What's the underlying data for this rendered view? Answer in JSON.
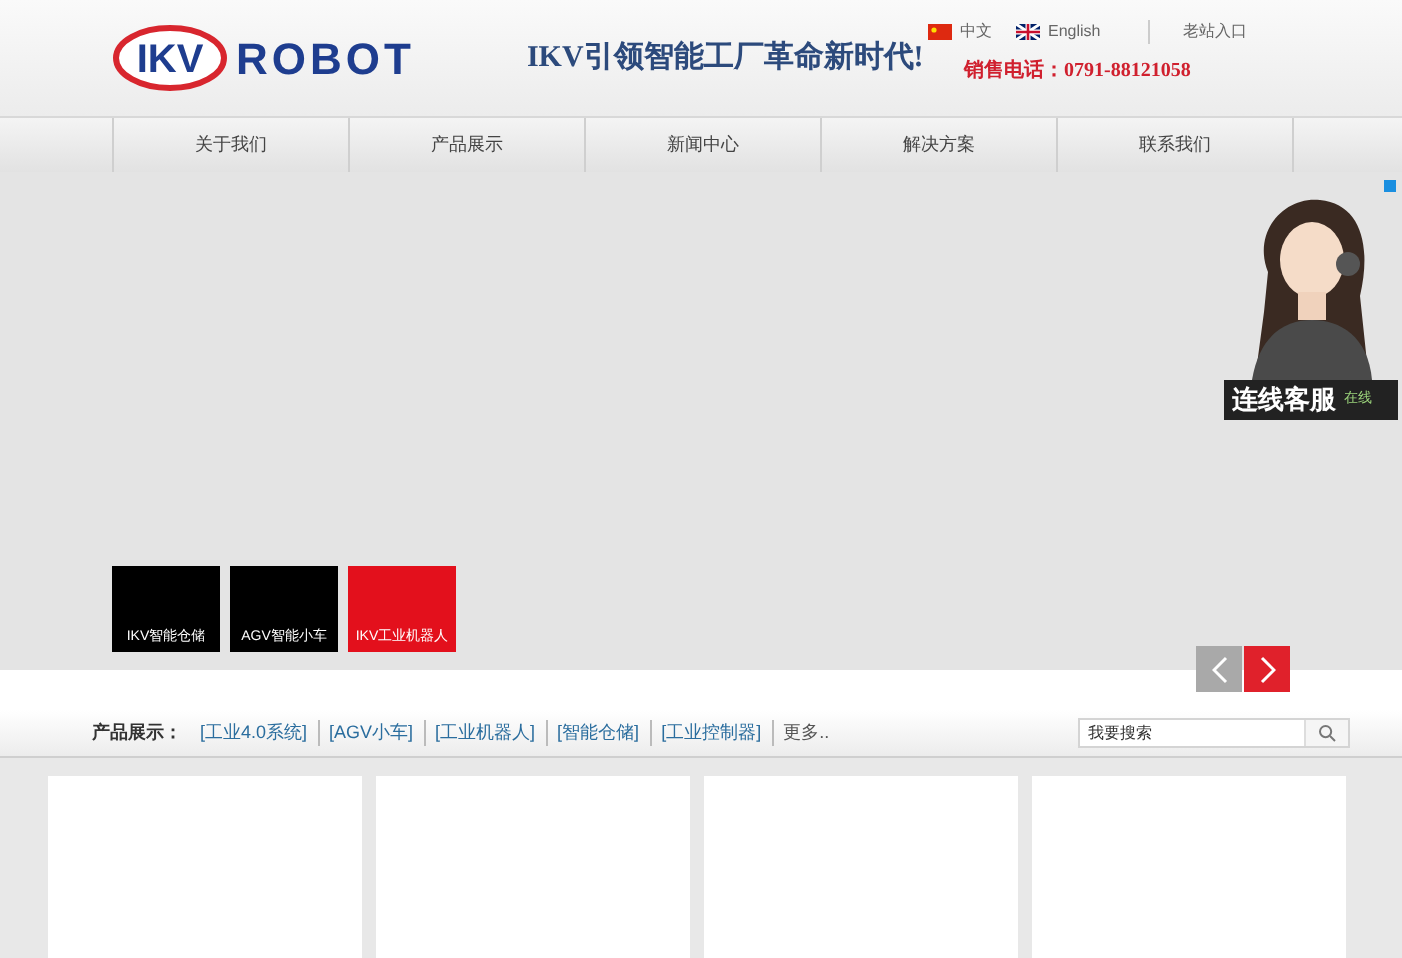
{
  "header": {
    "logo_mark": "IKV",
    "logo_text": "ROBOT",
    "tagline": "IKV引领智能工厂革命新时代!",
    "languages": [
      {
        "label": "中文",
        "kind": "cn"
      },
      {
        "label": "English",
        "kind": "uk"
      }
    ],
    "link": "老站入口",
    "hotline": "销售电话：0791-88121058"
  },
  "nav": [
    "关于我们",
    "产品展示",
    "新闻中心",
    "解决方案",
    "联系我们"
  ],
  "banner": {
    "thumbnails": [
      {
        "label": "IKV智能仓储",
        "selected": false
      },
      {
        "label": "AGV智能小车",
        "selected": false
      },
      {
        "label": "IKV工业机器人",
        "selected": true
      }
    ]
  },
  "service_widget": {
    "title": "连线客服",
    "status": "在线"
  },
  "products_bar": {
    "label": "产品展示：",
    "tags": [
      "[工业4.0系统]",
      "[AGV小车]",
      "[工业机器人]",
      "[智能仓储]",
      "[工业控制器]"
    ],
    "more": "更多..",
    "search": {
      "placeholder": "我要搜索"
    }
  },
  "cards": [
    {
      "kind": "blank"
    },
    {
      "kind": "blank"
    },
    {
      "kind": "blank"
    },
    {
      "kind": "blank"
    }
  ]
}
